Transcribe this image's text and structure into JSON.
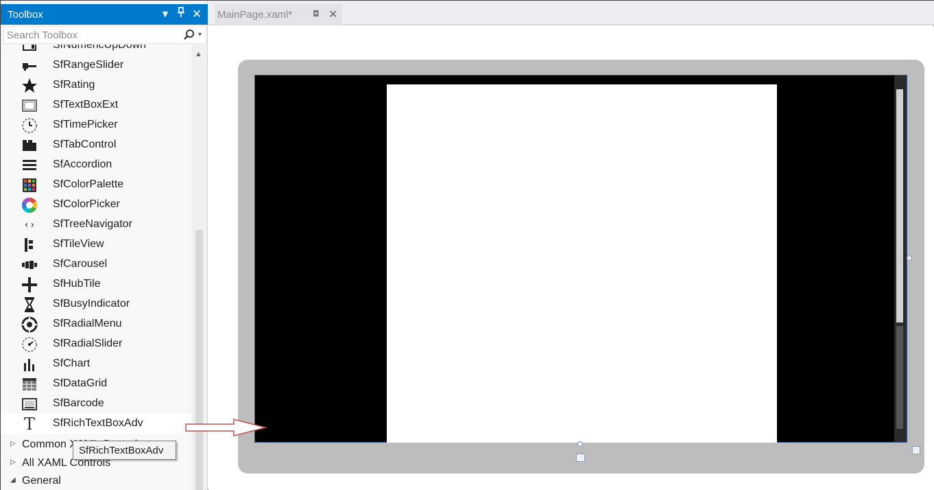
{
  "toolbox": {
    "title": "Toolbox",
    "search_placeholder": "Search Toolbox",
    "partial_item_label": "SfNumericUpDown",
    "items": [
      {
        "label": "SfRangeSlider",
        "icon": "range-slider-icon"
      },
      {
        "label": "SfRating",
        "icon": "star-icon"
      },
      {
        "label": "SfTextBoxExt",
        "icon": "textbox-icon"
      },
      {
        "label": "SfTimePicker",
        "icon": "clock-icon"
      },
      {
        "label": "SfTabControl",
        "icon": "tab-control-icon"
      },
      {
        "label": "SfAccordion",
        "icon": "accordion-icon"
      },
      {
        "label": "SfColorPalette",
        "icon": "color-palette-icon"
      },
      {
        "label": "SfColorPicker",
        "icon": "color-wheel-icon"
      },
      {
        "label": "SfTreeNavigator",
        "icon": "code-brackets-icon"
      },
      {
        "label": "SfTileView",
        "icon": "tile-view-icon"
      },
      {
        "label": "SfCarousel",
        "icon": "carousel-icon"
      },
      {
        "label": "SfHubTile",
        "icon": "hub-tile-icon"
      },
      {
        "label": "SfBusyIndicator",
        "icon": "hourglass-icon"
      },
      {
        "label": "SfRadialMenu",
        "icon": "radial-menu-icon"
      },
      {
        "label": "SfRadialSlider",
        "icon": "radial-slider-icon"
      },
      {
        "label": "SfChart",
        "icon": "bar-chart-icon"
      },
      {
        "label": "SfDataGrid",
        "icon": "data-grid-icon"
      },
      {
        "label": "SfBarcode",
        "icon": "barcode-icon"
      },
      {
        "label": "SfRichTextBoxAdv",
        "icon": "text-t-icon"
      }
    ],
    "groups": [
      {
        "label": "Common XAML Controls",
        "expanded": false
      },
      {
        "label": "All XAML Controls",
        "expanded": false
      },
      {
        "label": "General",
        "expanded": true
      }
    ],
    "tooltip": "SfRichTextBoxAdv"
  },
  "editor": {
    "tab_label": "MainPage.xaml*"
  },
  "colors": {
    "accent": "#007acc",
    "annotation_arrow": "#c0504d"
  }
}
